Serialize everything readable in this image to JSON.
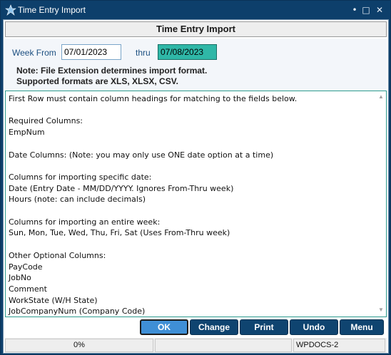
{
  "window": {
    "title": "Time Entry Import",
    "controls": {
      "minimize": "•",
      "maximize": "□",
      "close": "✕"
    }
  },
  "header": {
    "title": "Time Entry Import"
  },
  "form": {
    "week_from_label": "Week From",
    "week_from_value": "07/01/2023",
    "thru_label": "thru",
    "thru_value": "07/08/2023",
    "note_line1": "Note: File Extension determines import format.",
    "note_line2": "Supported formats are XLS, XLSX, CSV."
  },
  "instructions": {
    "lines": [
      "First Row must contain column headings for matching to the fields below.",
      "",
      "Required Columns:",
      "EmpNum",
      "",
      "Date Columns: (Note: you may only use ONE date option at a time)",
      "",
      "Columns for importing specific date:",
      "Date (Entry Date - MM/DD/YYYY.  Ignores From-Thru week)",
      "Hours (note: can include decimals)",
      "",
      "Columns for importing an entire week:",
      "Sun, Mon, Tue, Wed, Thu, Fri, Sat (Uses From-Thru week)",
      "",
      "Other Optional Columns:",
      "PayCode",
      "JobNo",
      "Comment",
      "WorkState (W/H State)",
      "JobCompanyNum (Company Code)"
    ]
  },
  "buttons": {
    "ok": "OK",
    "change": "Change",
    "print": "Print",
    "undo": "Undo",
    "menu": "Menu"
  },
  "status": {
    "progress": "0%",
    "middle": "",
    "database": "WPDOCS-2"
  },
  "colors": {
    "titlebar": "#0d3f6b",
    "button": "#0f4470",
    "primary_button": "#3f8fd6",
    "active_field": "#2fb7a7",
    "label": "#1c4f80"
  }
}
